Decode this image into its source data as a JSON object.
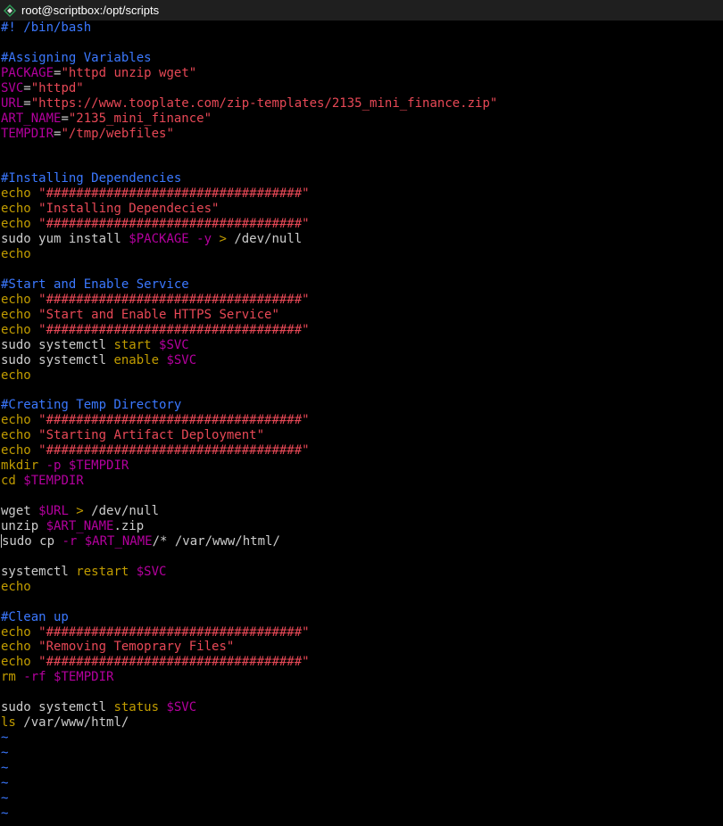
{
  "window": {
    "title": "root@scriptbox:/opt/scripts",
    "icon": "terminal-app-icon"
  },
  "colors": {
    "background": "#000000",
    "comment": "#3b78ff",
    "command": "#c19c00",
    "string": "#e74856",
    "variable": "#b4009e",
    "text": "#cccccc"
  },
  "lines": [
    [
      {
        "t": "#! /bin/bash",
        "c": "comment"
      }
    ],
    [],
    [
      {
        "t": "#Assigning Variables",
        "c": "comment"
      }
    ],
    [
      {
        "t": "PACKAGE",
        "c": "var"
      },
      {
        "t": "=",
        "c": "plain"
      },
      {
        "t": "\"httpd unzip wget\"",
        "c": "str"
      }
    ],
    [
      {
        "t": "SVC",
        "c": "var"
      },
      {
        "t": "=",
        "c": "plain"
      },
      {
        "t": "\"httpd\"",
        "c": "str"
      }
    ],
    [
      {
        "t": "URL",
        "c": "var"
      },
      {
        "t": "=",
        "c": "plain"
      },
      {
        "t": "\"https://www.tooplate.com/zip-templates/2135_mini_finance.zip\"",
        "c": "str"
      }
    ],
    [
      {
        "t": "ART_NAME",
        "c": "var"
      },
      {
        "t": "=",
        "c": "plain"
      },
      {
        "t": "\"2135_mini_finance\"",
        "c": "str"
      }
    ],
    [
      {
        "t": "TEMPDIR",
        "c": "var"
      },
      {
        "t": "=",
        "c": "plain"
      },
      {
        "t": "\"/tmp/webfiles\"",
        "c": "str"
      }
    ],
    [],
    [],
    [
      {
        "t": "#Installing Dependencies",
        "c": "comment"
      }
    ],
    [
      {
        "t": "echo ",
        "c": "cmd"
      },
      {
        "t": "\"##################################\"",
        "c": "str"
      }
    ],
    [
      {
        "t": "echo ",
        "c": "cmd"
      },
      {
        "t": "\"Installing Dependecies\"",
        "c": "str"
      }
    ],
    [
      {
        "t": "echo ",
        "c": "cmd"
      },
      {
        "t": "\"##################################\"",
        "c": "str"
      }
    ],
    [
      {
        "t": "sudo yum install ",
        "c": "plain"
      },
      {
        "t": "$PACKAGE",
        "c": "var"
      },
      {
        "t": " -y ",
        "c": "var"
      },
      {
        "t": "> ",
        "c": "cmd"
      },
      {
        "t": "/dev/null",
        "c": "plain"
      }
    ],
    [
      {
        "t": "echo",
        "c": "cmd"
      }
    ],
    [],
    [
      {
        "t": "#Start and Enable Service",
        "c": "comment"
      }
    ],
    [
      {
        "t": "echo ",
        "c": "cmd"
      },
      {
        "t": "\"##################################\"",
        "c": "str"
      }
    ],
    [
      {
        "t": "echo ",
        "c": "cmd"
      },
      {
        "t": "\"Start and Enable HTTPS Service\"",
        "c": "str"
      }
    ],
    [
      {
        "t": "echo ",
        "c": "cmd"
      },
      {
        "t": "\"##################################\"",
        "c": "str"
      }
    ],
    [
      {
        "t": "sudo systemctl ",
        "c": "plain"
      },
      {
        "t": "start ",
        "c": "cmd"
      },
      {
        "t": "$SVC",
        "c": "var"
      }
    ],
    [
      {
        "t": "sudo systemctl ",
        "c": "plain"
      },
      {
        "t": "enable ",
        "c": "cmd"
      },
      {
        "t": "$SVC",
        "c": "var"
      }
    ],
    [
      {
        "t": "echo",
        "c": "cmd"
      }
    ],
    [],
    [
      {
        "t": "#Creating Temp Directory",
        "c": "comment"
      }
    ],
    [
      {
        "t": "echo ",
        "c": "cmd"
      },
      {
        "t": "\"##################################\"",
        "c": "str"
      }
    ],
    [
      {
        "t": "echo ",
        "c": "cmd"
      },
      {
        "t": "\"Starting Artifact Deployment\"",
        "c": "str"
      }
    ],
    [
      {
        "t": "echo ",
        "c": "cmd"
      },
      {
        "t": "\"##################################\"",
        "c": "str"
      }
    ],
    [
      {
        "t": "mkdir ",
        "c": "cmd"
      },
      {
        "t": "-p ",
        "c": "var"
      },
      {
        "t": "$TEMPDIR",
        "c": "var"
      }
    ],
    [
      {
        "t": "cd ",
        "c": "cmd"
      },
      {
        "t": "$TEMPDIR",
        "c": "var"
      }
    ],
    [],
    [
      {
        "t": "wget ",
        "c": "plain"
      },
      {
        "t": "$URL",
        "c": "var"
      },
      {
        "t": " > ",
        "c": "cmd"
      },
      {
        "t": "/dev/null",
        "c": "plain"
      }
    ],
    [
      {
        "t": "unzip ",
        "c": "plain"
      },
      {
        "t": "$ART_NAME",
        "c": "var"
      },
      {
        "t": ".zip",
        "c": "plain"
      }
    ],
    [
      {
        "t": "CURSOR",
        "c": "cursor"
      },
      {
        "t": "sudo cp ",
        "c": "plain"
      },
      {
        "t": "-r ",
        "c": "var"
      },
      {
        "t": "$ART_NAME",
        "c": "var"
      },
      {
        "t": "/* /var/www/html/",
        "c": "plain"
      }
    ],
    [],
    [
      {
        "t": "systemctl ",
        "c": "plain"
      },
      {
        "t": "restart ",
        "c": "cmd"
      },
      {
        "t": "$SVC",
        "c": "var"
      }
    ],
    [
      {
        "t": "echo",
        "c": "cmd"
      }
    ],
    [],
    [
      {
        "t": "#Clean up",
        "c": "comment"
      }
    ],
    [
      {
        "t": "echo ",
        "c": "cmd"
      },
      {
        "t": "\"##################################\"",
        "c": "str"
      }
    ],
    [
      {
        "t": "echo ",
        "c": "cmd"
      },
      {
        "t": "\"Removing Temoprary Files\"",
        "c": "str"
      }
    ],
    [
      {
        "t": "echo ",
        "c": "cmd"
      },
      {
        "t": "\"##################################\"",
        "c": "str"
      }
    ],
    [
      {
        "t": "rm ",
        "c": "cmd"
      },
      {
        "t": "-rf ",
        "c": "var"
      },
      {
        "t": "$TEMPDIR",
        "c": "var"
      }
    ],
    [],
    [
      {
        "t": "sudo systemctl ",
        "c": "plain"
      },
      {
        "t": "status ",
        "c": "cmd"
      },
      {
        "t": "$SVC",
        "c": "var"
      }
    ],
    [
      {
        "t": "ls ",
        "c": "cmd"
      },
      {
        "t": "/var/www/html/",
        "c": "plain"
      }
    ],
    [
      {
        "t": "~",
        "c": "tilde"
      }
    ],
    [
      {
        "t": "~",
        "c": "tilde"
      }
    ],
    [
      {
        "t": "~",
        "c": "tilde"
      }
    ],
    [
      {
        "t": "~",
        "c": "tilde"
      }
    ],
    [
      {
        "t": "~",
        "c": "tilde"
      }
    ],
    [
      {
        "t": "~",
        "c": "tilde"
      }
    ]
  ]
}
